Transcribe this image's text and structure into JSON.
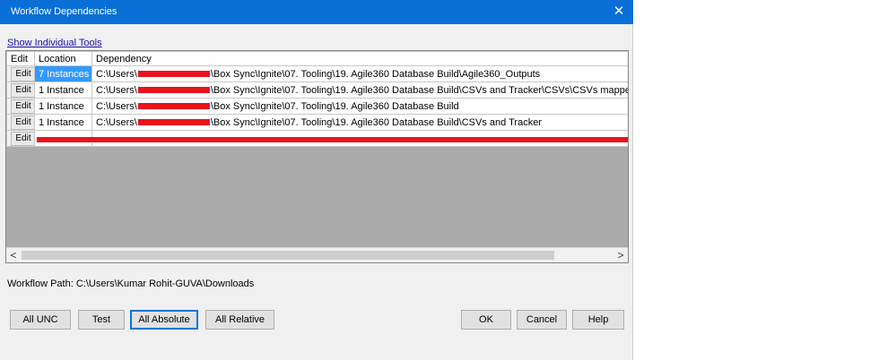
{
  "window": {
    "title": "Workflow Dependencies",
    "close_glyph": "✕"
  },
  "show_individual_tools": "Show Individual Tools",
  "table": {
    "headers": [
      "Edit",
      "Location",
      "Dependency"
    ],
    "rows": [
      {
        "edit": "Edit",
        "location": "7 Instances",
        "dep_prefix": "C:\\Users\\",
        "dep_suffix": "\\Box Sync\\Ignite\\07. Tooling\\19. Agile360 Database Build\\Agile360_Outputs"
      },
      {
        "edit": "Edit",
        "location": "1 Instance",
        "dep_prefix": "C:\\Users\\",
        "dep_suffix": "\\Box Sync\\Ignite\\07. Tooling\\19. Agile360 Database Build\\CSVs and Tracker\\CSVs\\CSVs mapped to Tracker"
      },
      {
        "edit": "Edit",
        "location": "1 Instance",
        "dep_prefix": "C:\\Users\\",
        "dep_suffix": "\\Box Sync\\Ignite\\07. Tooling\\19. Agile360 Database Build"
      },
      {
        "edit": "Edit",
        "location": "1 Instance",
        "dep_prefix": "C:\\Users\\",
        "dep_suffix": "\\Box Sync\\Ignite\\07. Tooling\\19. Agile360 Database Build\\CSVs and Tracker"
      },
      {
        "edit": "Edit",
        "location": "",
        "dep_prefix": "",
        "dep_suffix": ""
      }
    ]
  },
  "scrollbar": {
    "left_arrow": "<",
    "right_arrow": ">"
  },
  "workflow_path": "Workflow Path: C:\\Users\\Kumar Rohit-GUVA\\Downloads",
  "buttons": {
    "all_unc": "All UNC",
    "test": "Test",
    "all_absolute": "All Absolute",
    "all_relative": "All Relative",
    "ok": "OK",
    "cancel": "Cancel",
    "help": "Help"
  },
  "colors": {
    "titlebar": "#0a6fd6",
    "selected": "#3399ff",
    "redaction": "#e8141c"
  }
}
